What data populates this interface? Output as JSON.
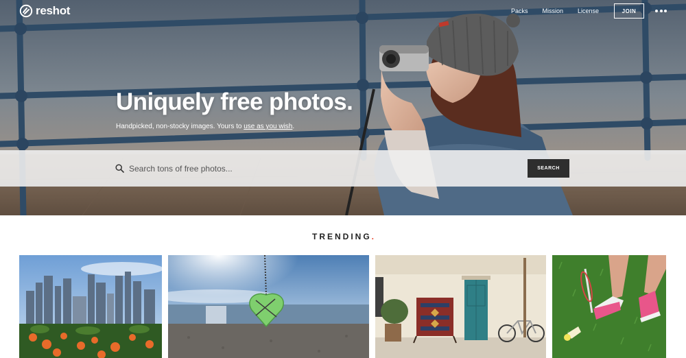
{
  "brand": {
    "name": "reshot"
  },
  "nav": {
    "links": [
      "Packs",
      "Mission",
      "License"
    ],
    "join_label": "JOIN"
  },
  "hero": {
    "headline": "Uniquely free photos.",
    "subline_prefix": "Handpicked, non-stocky images. Yours to ",
    "subline_link": "use as you wish",
    "subline_suffix": "."
  },
  "search": {
    "placeholder": "Search tons of free photos...",
    "button_label": "SEARCH"
  },
  "trending": {
    "title": "TRENDING",
    "dot": "."
  },
  "colors": {
    "accent": "#e8442b",
    "search_button": "#2e2e2e"
  }
}
